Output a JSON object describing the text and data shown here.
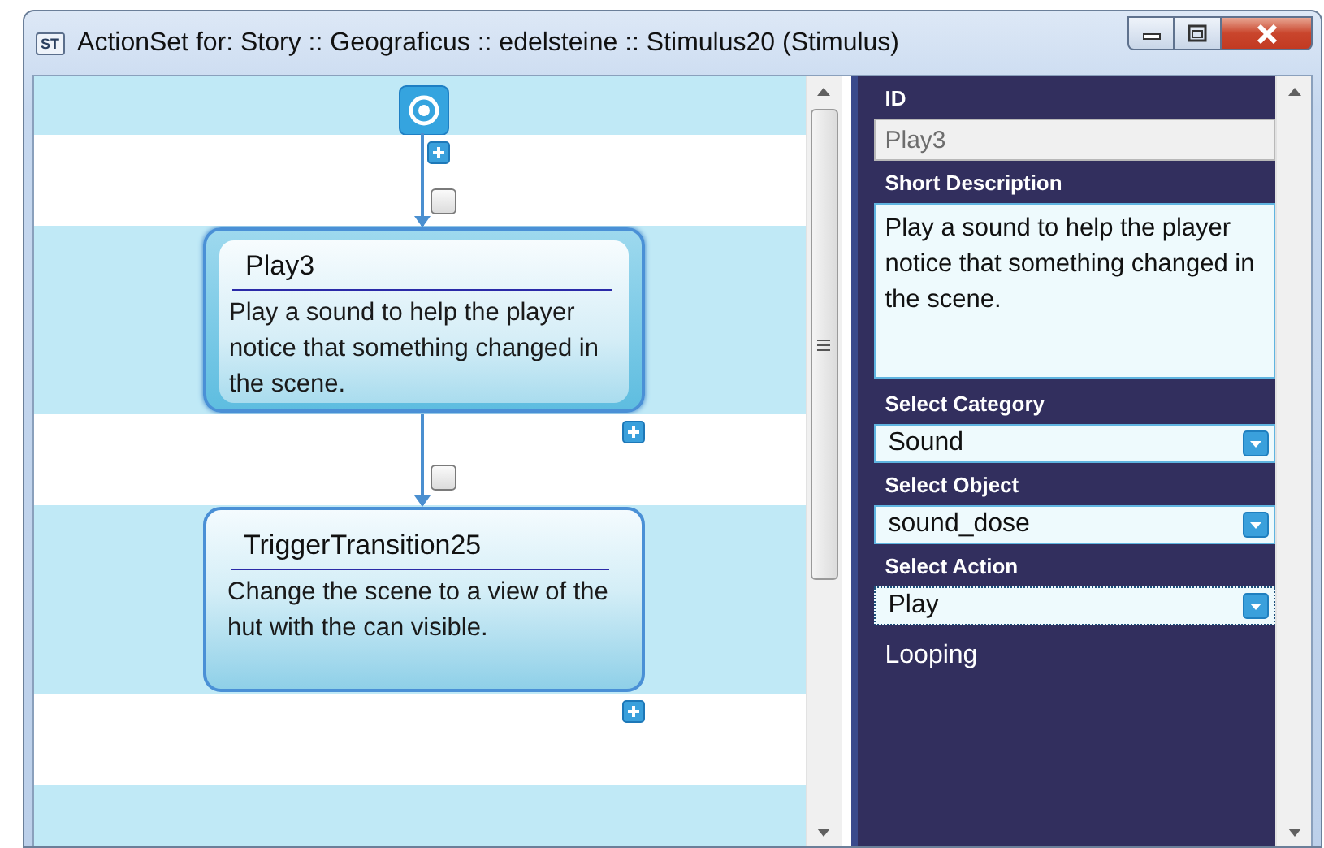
{
  "window": {
    "title": "ActionSet for: Story :: Geograficus :: edelsteine :: Stimulus20 (Stimulus)",
    "app_icon": "ST"
  },
  "canvas": {
    "nodes": [
      {
        "title": "Play3",
        "description": "Play a sound to help the player notice that something changed in the scene.",
        "selected": true
      },
      {
        "title": "TriggerTransition25",
        "description": "Change the scene to a view of the hut with the can visible.",
        "selected": false
      }
    ],
    "connectors": [
      {
        "checked": false
      },
      {
        "checked": false
      }
    ]
  },
  "properties": {
    "fields": [
      {
        "kind": "text",
        "label": "ID",
        "value": "Play3",
        "disabled": true
      },
      {
        "kind": "textarea",
        "label": "Short Description",
        "value": "Play a sound to help the player notice that something changed in the scene."
      },
      {
        "kind": "combo",
        "label": "Select Category",
        "value": "Sound",
        "focused": false
      },
      {
        "kind": "combo",
        "label": "Select Object",
        "value": "sound_dose",
        "focused": false
      },
      {
        "kind": "combo",
        "label": "Select Action",
        "value": "Play",
        "focused": true
      },
      {
        "kind": "label",
        "label": "Looping"
      }
    ]
  }
}
